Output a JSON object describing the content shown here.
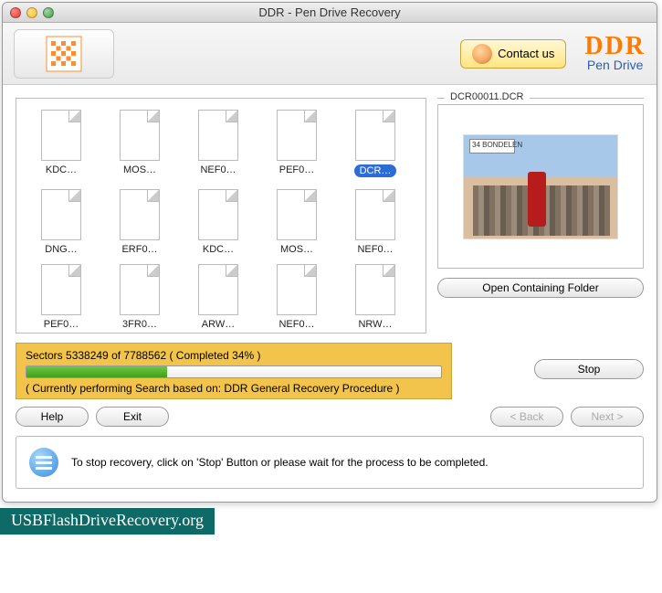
{
  "window": {
    "title": "DDR - Pen Drive Recovery"
  },
  "toolbar": {
    "contact_label": "Contact us",
    "brand_top": "DDR",
    "brand_sub": "Pen Drive"
  },
  "files": [
    {
      "label": "KDC…",
      "selected": false
    },
    {
      "label": "MOS…",
      "selected": false
    },
    {
      "label": "NEF0…",
      "selected": false
    },
    {
      "label": "PEF0…",
      "selected": false
    },
    {
      "label": "DCR…",
      "selected": true
    },
    {
      "label": "DNG…",
      "selected": false
    },
    {
      "label": "ERF0…",
      "selected": false
    },
    {
      "label": "KDC…",
      "selected": false
    },
    {
      "label": "MOS…",
      "selected": false
    },
    {
      "label": "NEF0…",
      "selected": false
    },
    {
      "label": "PEF0…",
      "selected": false
    },
    {
      "label": "3FR0…",
      "selected": false
    },
    {
      "label": "ARW…",
      "selected": false
    },
    {
      "label": "NEF0…",
      "selected": false
    },
    {
      "label": "NRW…",
      "selected": false
    }
  ],
  "preview": {
    "title": "DCR00011.DCR",
    "open_folder_label": "Open Containing Folder"
  },
  "progress": {
    "sectors_line": "Sectors 5338249 of 7788562   ( Completed 34% )",
    "search_line": "( Currently performing Search based on: DDR General Recovery Procedure )",
    "percent": 34,
    "stop_label": "Stop"
  },
  "nav": {
    "help": "Help",
    "exit": "Exit",
    "back": "< Back",
    "next": "Next >"
  },
  "info": {
    "text": "To stop recovery, click on 'Stop' Button or please wait for the process to be completed."
  },
  "watermark": "USBFlashDriveRecovery.org"
}
